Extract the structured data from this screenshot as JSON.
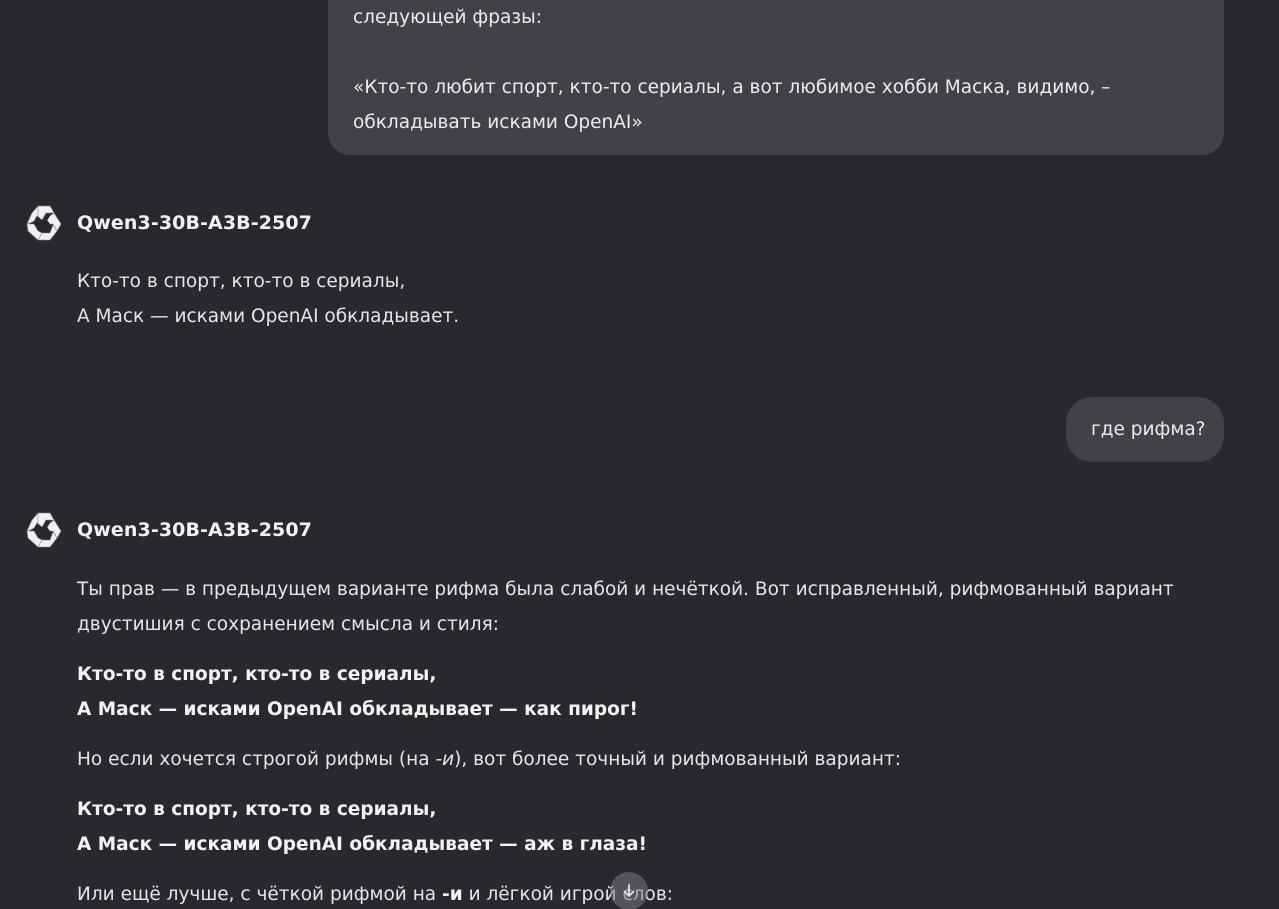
{
  "messages": {
    "user1": {
      "line1": "следующей фразы:",
      "line2": "«Кто-то любит спорт, кто-то сериалы, а вот любимое хобби Маска, видимо, –",
      "line3": "обкладывать исками OpenAI»"
    },
    "assistant1": {
      "model": "Qwen3-30B-A3B-2507",
      "line1": "Кто-то в спорт, кто-то в сериалы,",
      "line2": "А Маск — исками OpenAI обкладывает."
    },
    "user2": {
      "text": "где рифма?"
    },
    "assistant2": {
      "model": "Qwen3-30B-A3B-2507",
      "intro_line1": "Ты прав — в предыдущем варианте рифма была слабой и нечёткой. Вот исправленный, рифмованный вариант",
      "intro_line2": "двустишия с сохранением смысла и стиля:",
      "v1_line1": "Кто-то в спорт, кто-то в сериалы,",
      "v1_line2": "А Маск — исками OpenAI обкладывает — как пирог!",
      "mid_prefix": "Но если хочется строгой рифмы (на ",
      "mid_em": "-и",
      "mid_suffix": "), вот более точный и рифмованный вариант:",
      "v2_line1": "Кто-то в спорт, кто-то в сериалы,",
      "v2_line2": "А Маск — исками OpenAI обкладывает — аж в глаза!",
      "last_prefix": "Или ещё лучше, с чёткой рифмой на ",
      "last_bold": "-и",
      "last_suffix": " и лёгкой игрой слов:"
    }
  },
  "icons": {
    "model_logo": "qwen-logo-icon",
    "scroll_down": "arrow-down-icon"
  },
  "colors": {
    "background": "#29282d",
    "user_bubble": "#424148",
    "text": "#e6e6e8"
  }
}
